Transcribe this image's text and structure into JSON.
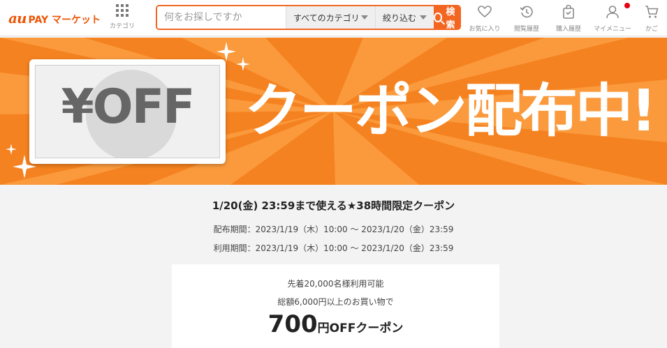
{
  "header": {
    "logo_au": "au",
    "logo_pay": "PAY マーケット",
    "category_label": "カテゴリ",
    "search": {
      "placeholder": "何をお探しですか",
      "category_select": "すべてのカテゴリ",
      "filter_select": "絞り込む",
      "button_label": "検索"
    },
    "nav": {
      "favorites": "お気に入り",
      "history": "閲覧履歴",
      "purchases": "購入履歴",
      "mymenu": "マイメニュー",
      "cart": "かご"
    },
    "accent_color": "#f26622",
    "badge_color": "#e60012"
  },
  "banner": {
    "coupon_graphic": "¥OFF",
    "title": "クーポン配布中!",
    "background_color": "#f58220"
  },
  "promo": {
    "headline": "1/20(金) 23:59まで使える★38時間限定クーポン",
    "distribution_period": "配布期間：2023/1/19（木）10:00 ～ 2023/1/20（金）23:59",
    "usage_period": "利用期間：2023/1/19（木）10:00 ～ 2023/1/20（金）23:59"
  },
  "coupon_card": {
    "limit": "先着20,000名様利用可能",
    "condition": "総額6,000円以上のお買い物で",
    "amount": "700",
    "yen": "円",
    "label": "OFFクーポン"
  }
}
